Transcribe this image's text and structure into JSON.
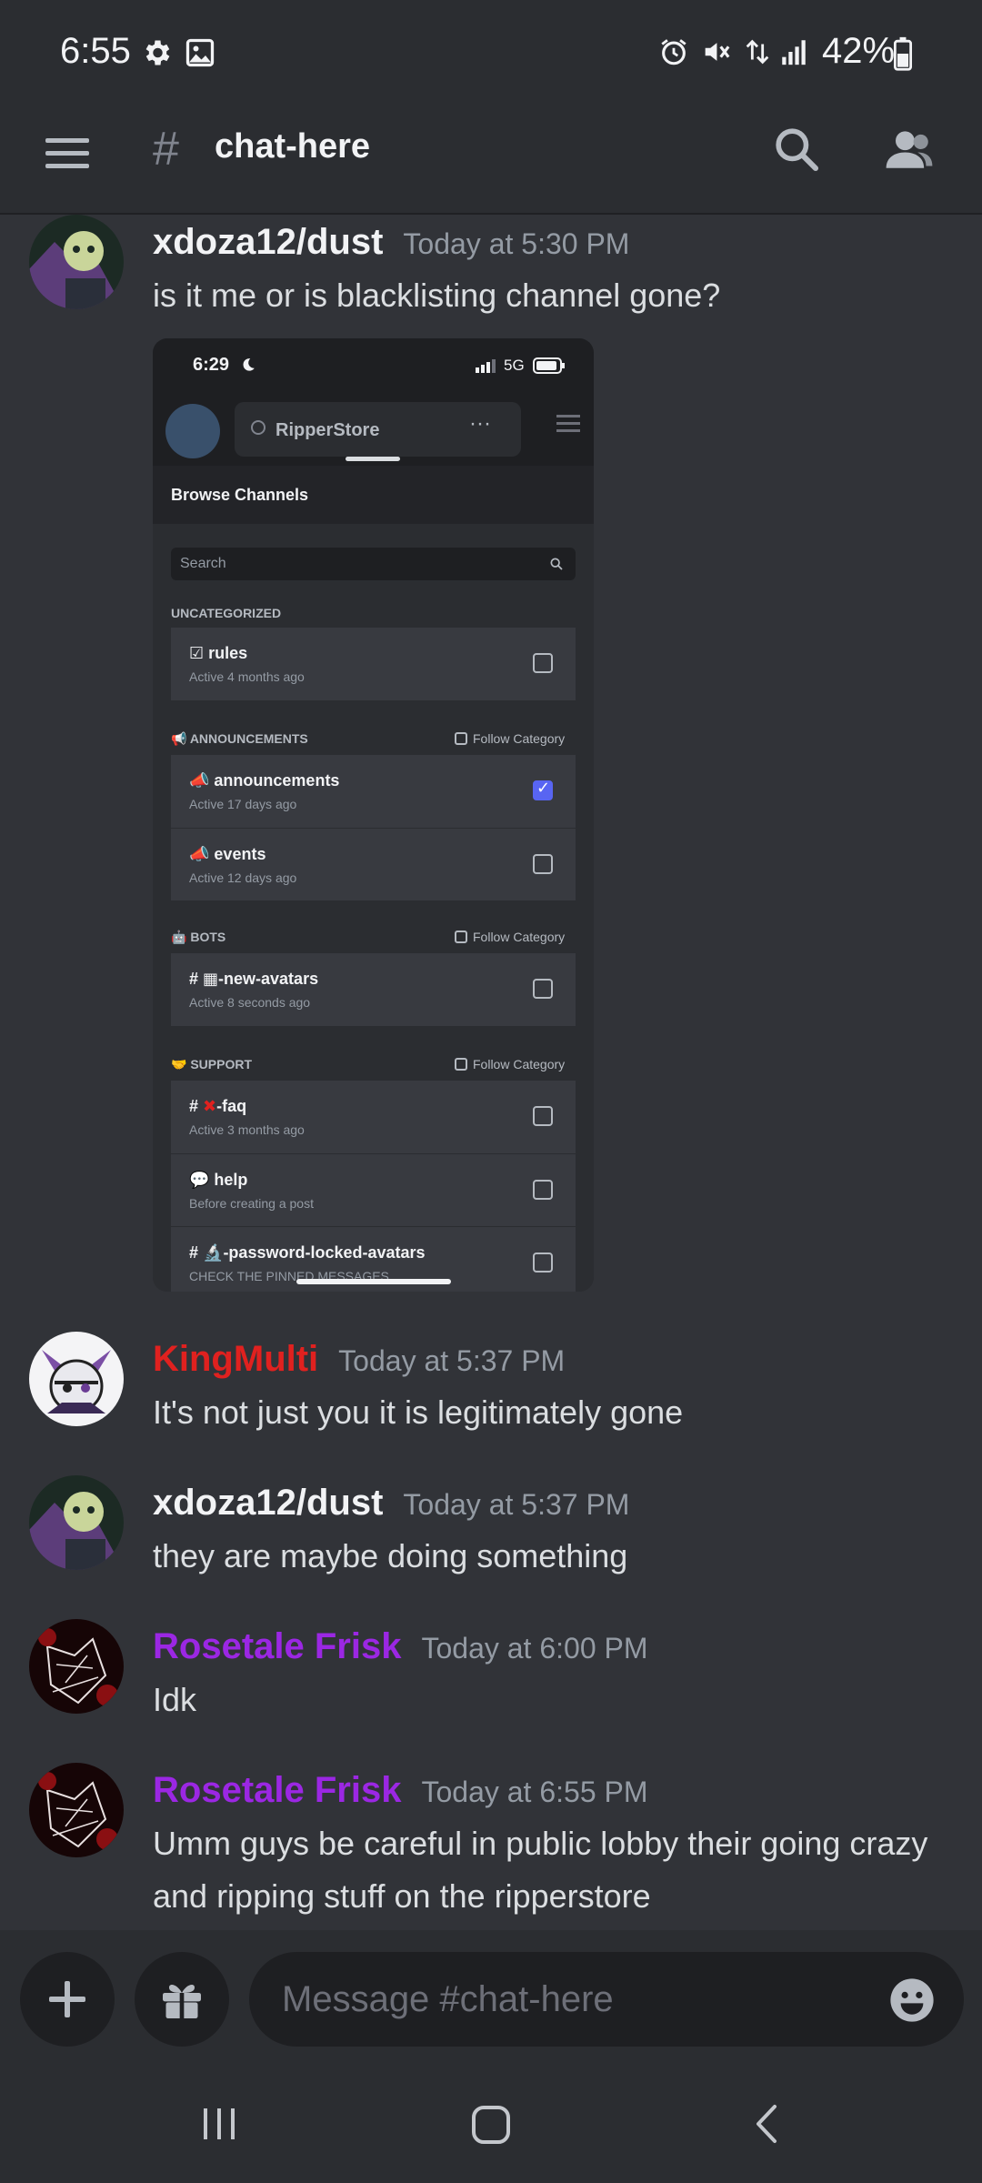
{
  "status_bar": {
    "time": "6:55",
    "battery": "42%"
  },
  "header": {
    "hash": "#",
    "channel_name": "chat-here"
  },
  "messages": [
    {
      "author": "xdoza12/dust",
      "author_color": "#f2f3f5",
      "timestamp": "Today at 5:30 PM",
      "text": "is it me or is blacklisting channel gone?"
    },
    {
      "author": "KingMulti",
      "author_color": "#e0211f",
      "timestamp": "Today at 5:37 PM",
      "text": "It's not just you it is legitimately gone"
    },
    {
      "author": "xdoza12/dust",
      "author_color": "#f2f3f5",
      "timestamp": "Today at 5:37 PM",
      "text": "they are maybe doing something"
    },
    {
      "author": "Rosetale Frisk",
      "author_color": "#9b27e3",
      "timestamp": "Today at 6:00 PM",
      "text": "Idk"
    },
    {
      "author": "Rosetale Frisk",
      "author_color": "#9b27e3",
      "timestamp": "Today at 6:55 PM",
      "text": "Umm guys be careful in public lobby their going crazy and ripping stuff on the ripperstore"
    }
  ],
  "embed": {
    "time": "6:29",
    "network": "5G",
    "server_name": "RipperStore",
    "sheet_title": "Browse Channels",
    "search_placeholder": "Search",
    "follow_label": "Follow Category",
    "categories": [
      {
        "name": "UNCATEGORIZED",
        "channels": [
          {
            "name": "rules",
            "sub": "Active 4 months ago",
            "checked": false
          }
        ]
      },
      {
        "name": "ANNOUNCEMENTS",
        "channels": [
          {
            "name": "announcements",
            "sub": "Active 17 days ago",
            "checked": true
          },
          {
            "name": "events",
            "sub": "Active 12 days ago",
            "checked": false
          }
        ]
      },
      {
        "name": "BOTS",
        "channels": [
          {
            "name": "-new-avatars",
            "sub": "Active 8 seconds ago",
            "checked": false
          }
        ]
      },
      {
        "name": "SUPPORT",
        "channels": [
          {
            "name": "-faq",
            "sub": "Active 3 months ago",
            "checked": false
          },
          {
            "name": "help",
            "sub": "Before creating a post",
            "checked": false
          },
          {
            "name": "-password-locked-avatars",
            "sub": "CHECK THE PINNED MESSAGES",
            "checked": false
          }
        ]
      }
    ]
  },
  "composer": {
    "placeholder": "Message #chat-here"
  },
  "icons": {
    "settings": "gear-icon",
    "gallery": "image-icon",
    "alarm": "alarm-icon",
    "mute": "mute-icon",
    "data": "data-icon",
    "signal": "signal-icon",
    "battery": "battery-icon",
    "menu": "hamburger-icon",
    "search": "search-icon",
    "members": "members-icon",
    "add": "plus-icon",
    "gift": "gift-icon",
    "emoji": "emoji-icon"
  }
}
